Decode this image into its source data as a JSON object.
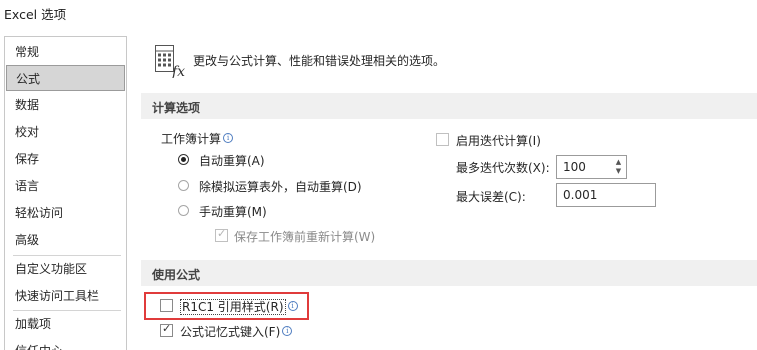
{
  "window": {
    "title": "Excel 选项"
  },
  "sidebar": {
    "items": [
      {
        "label": "常规"
      },
      {
        "label": "公式"
      },
      {
        "label": "数据"
      },
      {
        "label": "校对"
      },
      {
        "label": "保存"
      },
      {
        "label": "语言"
      },
      {
        "label": "轻松访问"
      },
      {
        "label": "高级"
      },
      {
        "label": "自定义功能区"
      },
      {
        "label": "快速访问工具栏"
      },
      {
        "label": "加载项"
      },
      {
        "label": "信任中心"
      }
    ],
    "active_index": 1
  },
  "header": {
    "icon": "formula-fx-icon",
    "text": "更改与公式计算、性能和错误处理相关的选项。"
  },
  "calc_section": {
    "title": "计算选项",
    "workbook_calc_label": "工作簿计算",
    "options": [
      {
        "label": "自动重算(A)",
        "selected": true
      },
      {
        "label": "除模拟运算表外，自动重算(D)",
        "selected": false
      },
      {
        "label": "手动重算(M)",
        "selected": false
      }
    ],
    "save_before_recalc": {
      "label": "保存工作簿前重新计算(W)",
      "checked": true,
      "enabled": false
    },
    "iterative": {
      "label": "启用迭代计算(I)",
      "checked": false
    },
    "max_iterations": {
      "label": "最多迭代次数(X):",
      "value": "100"
    },
    "max_change": {
      "label": "最大误差(C):",
      "value": "0.001"
    }
  },
  "formula_section": {
    "title": "使用公式",
    "r1c1": {
      "label": "R1C1 引用样式(R)",
      "checked": false
    },
    "autocomplete": {
      "label": "公式记忆式键入(F)",
      "checked": true
    }
  },
  "colors": {
    "highlight": "#e03b3b",
    "active_nav": "#d6d6d6",
    "section_bg": "#f0f0f0",
    "info": "#4f7dc0"
  }
}
